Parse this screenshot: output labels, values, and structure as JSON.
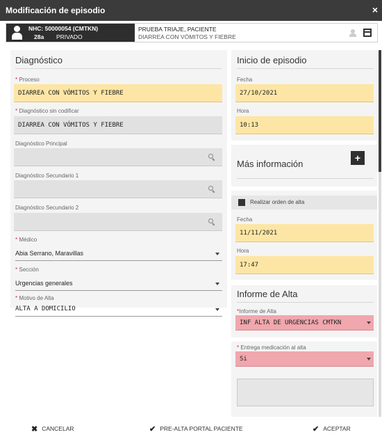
{
  "window": {
    "title": "Modificación de episodio",
    "close_glyph": "×"
  },
  "patient": {
    "nhc": "NHC: 50000054 (CMTKN)",
    "age": "28a",
    "plan": "PRIVADO",
    "name": "PRUEBA TRIAJE, PACIENTE",
    "diagnosis": "DIARREA CON VÓMITOS Y FIEBRE",
    "icons": [
      "person-icon",
      "user-icon",
      "print-icon"
    ]
  },
  "diagnostico": {
    "title": "Diagnóstico",
    "proceso": {
      "label": "Proceso",
      "value": "DIARREA CON VÓMITOS Y FIEBRE"
    },
    "sin_codificar": {
      "label": "Diagnóstico sin codificar",
      "value": "DIARREA CON VÓMITOS Y FIEBRE"
    },
    "principal": {
      "label": "Diagnóstico Principal",
      "value": ""
    },
    "secundario1": {
      "label": "Diagnóstico Secundario 1",
      "value": ""
    },
    "secundario2": {
      "label": "Diagnóstico Secundario 2",
      "value": ""
    },
    "medico": {
      "label": "Médico",
      "value": "Abia Serrano, Maravillas"
    },
    "seccion": {
      "label": "Sección",
      "value": "Urgencias generales"
    },
    "motivo": {
      "label": "Motivo de Alta",
      "value": "ALTA A DOMICILIO"
    },
    "required_mark": "*"
  },
  "inicio": {
    "title": "Inicio de episodio",
    "fecha": {
      "label": "Fecha",
      "value": "27/10/2021"
    },
    "hora": {
      "label": "Hora",
      "value": "10:13"
    }
  },
  "mas_info": {
    "title": "Más información",
    "plus": "+"
  },
  "alta": {
    "checkbox_label": "Realizar orden de alta",
    "fecha": {
      "label": "Fecha",
      "value": "11/11/2021"
    },
    "hora": {
      "label": "Hora",
      "value": "17:47"
    }
  },
  "informe": {
    "title": "Informe de Alta",
    "informe_field": {
      "label": "Informe de Alta",
      "value": "INF ALTA DE URGENCIAS CMTKN"
    },
    "entrega": {
      "label": "Entrega medicación al alta",
      "value": "Si"
    }
  },
  "footer": {
    "cancel": "CANCELAR",
    "pre_alta": "PRE-ALTA PORTAL PACIENTE",
    "accept": "ACEPTAR",
    "cancel_icon": "✖",
    "check_icon": "✔"
  },
  "colors": {
    "yellow": "#fde6a5",
    "pink": "#f0a7ad",
    "gray": "#e1e1e1",
    "required": "#d9263f",
    "titlebar": "#3b3b3b"
  }
}
